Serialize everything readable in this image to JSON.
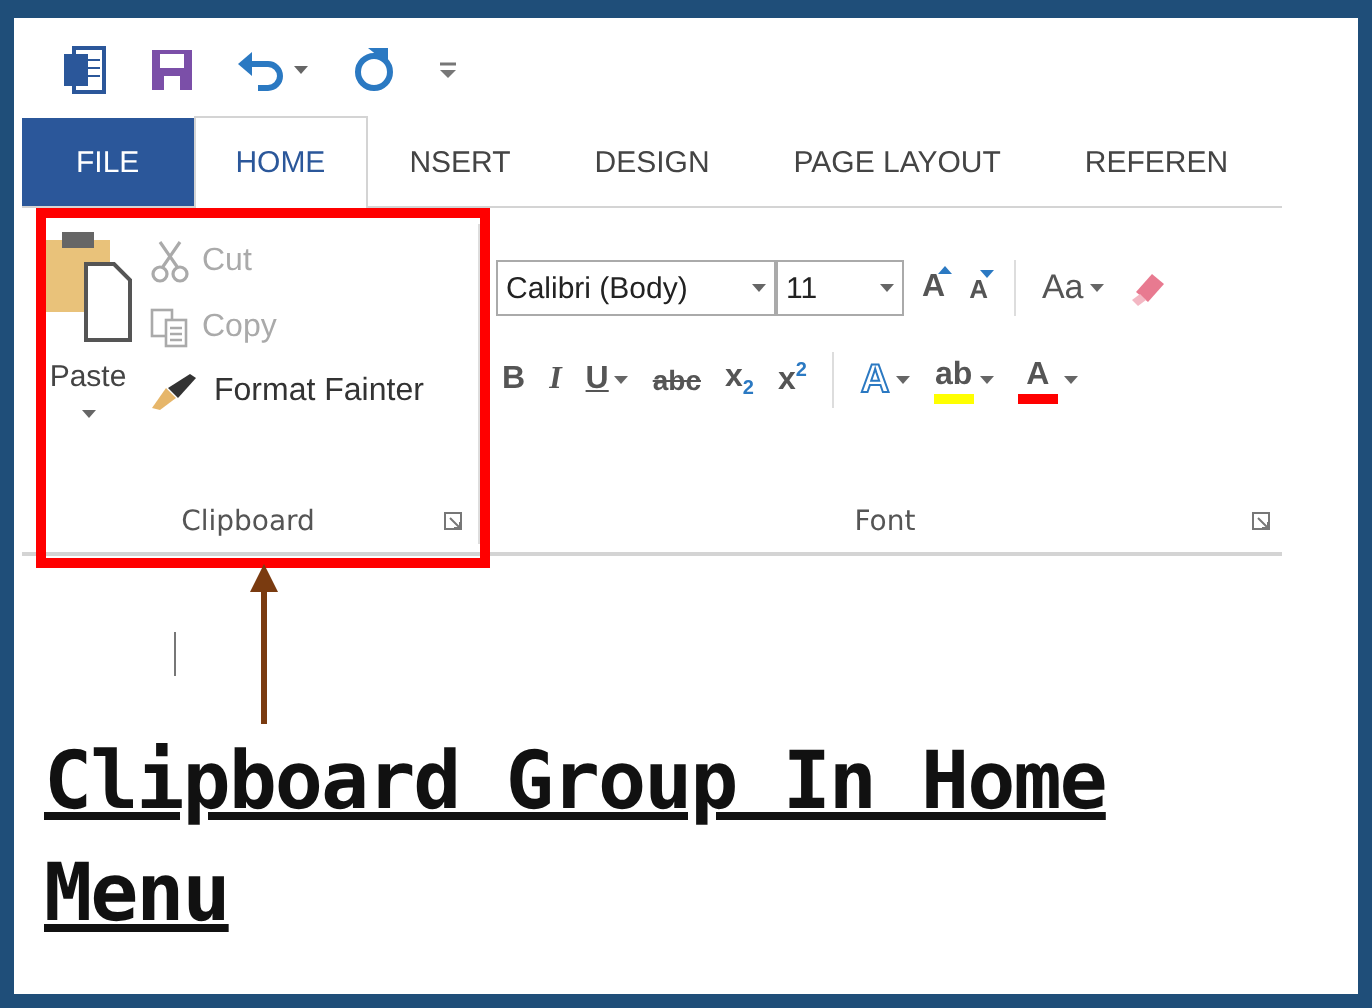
{
  "tabs": [
    {
      "label": "FILE",
      "kind": "backstage",
      "selected": false
    },
    {
      "label": "HOME",
      "kind": "tab",
      "selected": true
    },
    {
      "label": "NSERT",
      "kind": "tab",
      "selected": false
    },
    {
      "label": "DESIGN",
      "kind": "tab",
      "selected": false
    },
    {
      "label": "PAGE LAYOUT",
      "kind": "tab",
      "selected": false
    },
    {
      "label": "REFEREN",
      "kind": "tab",
      "selected": false
    }
  ],
  "clipboard": {
    "paste": {
      "label": "Paste"
    },
    "commands": [
      {
        "label": "Cut",
        "kind": "cut",
        "disabled": true
      },
      {
        "label": "Copy",
        "kind": "copy",
        "disabled": true
      },
      {
        "label": "Format Fainter",
        "kind": "painter",
        "disabled": false
      }
    ],
    "label": "Clipboard"
  },
  "font": {
    "font_name": "Calibri (Body)",
    "font_size": "11",
    "row1": [
      {
        "kind": "grow",
        "label": "A",
        "dropdown": false
      },
      {
        "kind": "shrink",
        "label": "A",
        "dropdown": false
      },
      {
        "kind": "case",
        "label": "Aa",
        "dropdown": true
      },
      {
        "kind": "clear",
        "dropdown": false
      }
    ],
    "row2": [
      {
        "kind": "bold",
        "label": "B",
        "dropdown": false
      },
      {
        "kind": "italic",
        "label": "I",
        "dropdown": false
      },
      {
        "kind": "underline",
        "label": "U",
        "dropdown": true
      },
      {
        "kind": "strike",
        "label": "abc",
        "dropdown": false
      },
      {
        "kind": "subscript",
        "label": "x$_{2}$",
        "dropdown": false
      },
      {
        "kind": "superscript",
        "label": "x$^{2}$",
        "dropdown": false
      },
      {
        "kind": "effects",
        "label": "A",
        "dropdown": true
      },
      {
        "kind": "highlight",
        "label": "ab",
        "dropdown": true,
        "color": "#ffff00"
      },
      {
        "kind": "color",
        "label": "A",
        "dropdown": true,
        "color": "#ff0000"
      }
    ],
    "label": "Font"
  },
  "annotation": {
    "caption": "Clipboard Group In Home Menu"
  }
}
